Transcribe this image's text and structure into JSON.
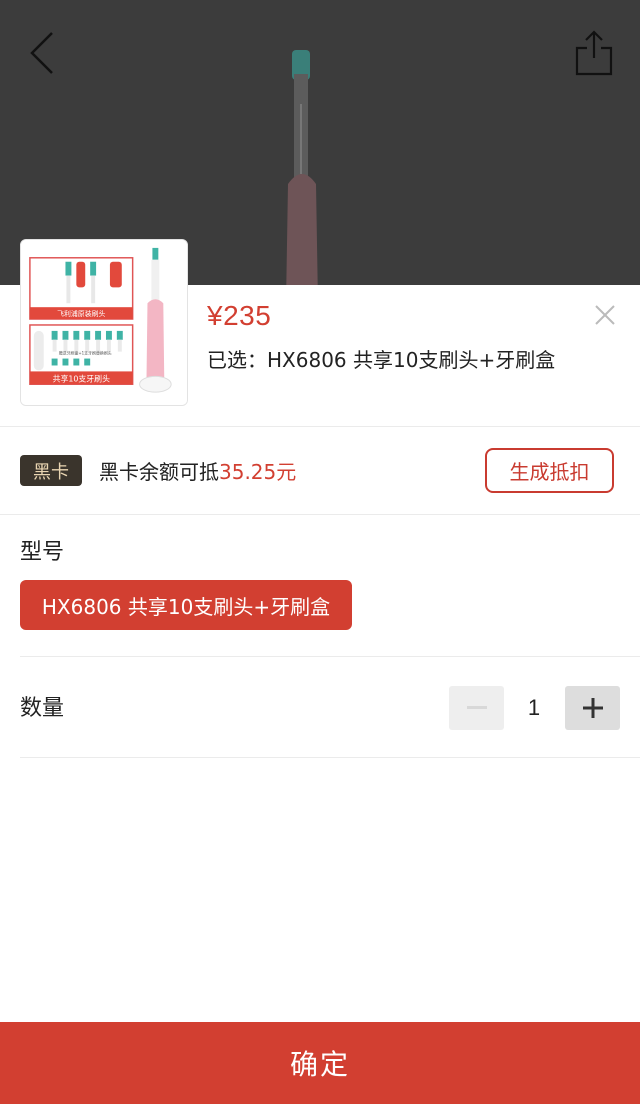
{
  "header": {
    "back_icon": "chevron-left-icon",
    "share_icon": "share-icon"
  },
  "product": {
    "price": "¥235",
    "selected_text": "已选：HX6806 共享10支刷头+牙刷盒",
    "thumbnail_caption_top": "飞利浦原装刷头",
    "thumbnail_caption_bottom": "共享10支牙刷头",
    "thumbnail_caption_small": "赠送牙刷盒+1支牙刷替换刷头"
  },
  "black_card": {
    "badge": "黑卡",
    "text": "黑卡余额可抵",
    "amount": "35.25元",
    "button_label": "生成抵扣"
  },
  "model": {
    "label": "型号",
    "options": [
      "HX6806 共享10支刷头+牙刷盒"
    ],
    "selected_index": 0
  },
  "quantity": {
    "label": "数量",
    "value": "1",
    "minus_icon": "minus-icon",
    "plus_icon": "plus-icon"
  },
  "footer": {
    "confirm_label": "确定"
  },
  "colors": {
    "accent": "#d23f31",
    "badge_bg": "#3a342c",
    "badge_text": "#e9d5b2",
    "overlay": "#3c3c3c"
  }
}
